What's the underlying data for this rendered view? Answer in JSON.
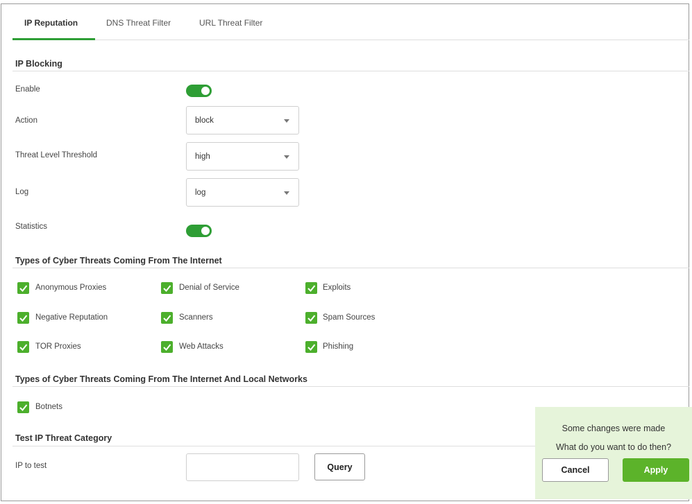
{
  "tabs": [
    {
      "label": "IP Reputation",
      "active": true
    },
    {
      "label": "DNS Threat Filter",
      "active": false
    },
    {
      "label": "URL Threat Filter",
      "active": false
    }
  ],
  "ip_blocking": {
    "title": "IP Blocking",
    "enable_label": "Enable",
    "enable_on": true,
    "action_label": "Action",
    "action_value": "block",
    "threshold_label": "Threat Level Threshold",
    "threshold_value": "high",
    "log_label": "Log",
    "log_value": "log",
    "statistics_label": "Statistics",
    "statistics_on": true
  },
  "internet_threats": {
    "title": "Types of Cyber Threats Coming From The Internet",
    "items": [
      {
        "label": "Anonymous Proxies",
        "checked": true
      },
      {
        "label": "Denial of Service",
        "checked": true
      },
      {
        "label": "Exploits",
        "checked": true
      },
      {
        "label": "Negative Reputation",
        "checked": true
      },
      {
        "label": "Scanners",
        "checked": true
      },
      {
        "label": "Spam Sources",
        "checked": true
      },
      {
        "label": "TOR Proxies",
        "checked": true
      },
      {
        "label": "Web Attacks",
        "checked": true
      },
      {
        "label": "Phishing",
        "checked": true
      }
    ]
  },
  "local_threats": {
    "title": "Types of Cyber Threats Coming From The Internet And Local Networks",
    "items": [
      {
        "label": "Botnets",
        "checked": true
      }
    ]
  },
  "test_ip": {
    "title": "Test IP Threat Category",
    "ip_label": "IP to test",
    "query_label": "Query"
  },
  "popup": {
    "line1": "Some changes were made",
    "line2": "What do you want to do then?",
    "cancel_label": "Cancel",
    "apply_label": "Apply"
  },
  "colors": {
    "accent": "#4caf2c",
    "toggle": "#2e9e35",
    "apply": "#5cb32a",
    "popup_bg": "#e6f4da"
  },
  "icons": {
    "checkbox": "checkbox-checked-icon",
    "dropdown": "chevron-down-icon"
  }
}
